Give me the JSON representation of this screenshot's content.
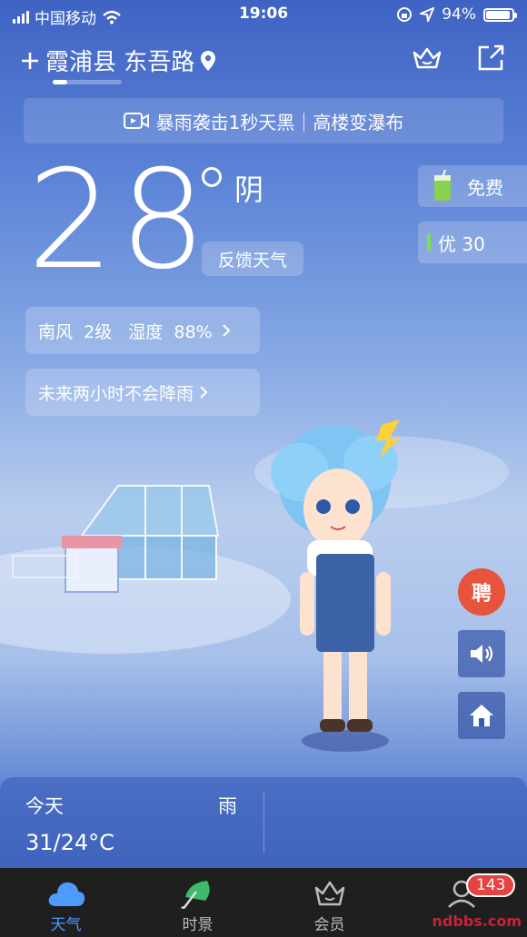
{
  "status_bar": {
    "carrier": "中国移动",
    "time": "19:06",
    "battery": "94%",
    "battery_level": 0.94
  },
  "header": {
    "location": "霞浦县 东吾路",
    "icons": [
      "add-icon",
      "location-pin-icon",
      "crown-icon",
      "share-icon"
    ]
  },
  "banner": {
    "text": "暴雨袭击1秒天黑｜高楼变瀑布",
    "icon": "video-icon"
  },
  "weather": {
    "temperature": "28",
    "condition": "阴",
    "feedback_label": "反馈天气",
    "wind_humidity": "南风  2级   湿度  88%",
    "rain_forecast": "未来两小时不会降雨"
  },
  "side_chips": {
    "free_label": "免费",
    "aqi_label": "优 30",
    "aqi_color": "#7ddf4a"
  },
  "floating": {
    "recruit_label": "聘",
    "recruit_color": "#e8533c",
    "icons": [
      "speaker-icon",
      "home-icon"
    ]
  },
  "forecast_card": {
    "day": "今天",
    "condition": "雨",
    "range": "31/24°C"
  },
  "tabbar": {
    "tabs": [
      {
        "label": "天气",
        "icon": "cloud-icon",
        "active": true
      },
      {
        "label": "时景",
        "icon": "umbrella-icon",
        "active": false
      },
      {
        "label": "会员",
        "icon": "crown-icon",
        "active": false
      },
      {
        "label": "",
        "icon": "profile-icon",
        "active": false
      }
    ],
    "badge": "143",
    "active_color": "#4d9bff"
  },
  "watermark": "ndbbs.com"
}
